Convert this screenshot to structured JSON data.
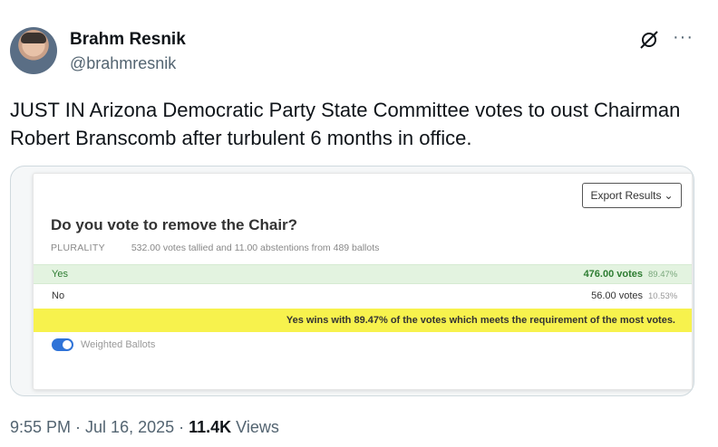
{
  "author": {
    "name": "Brahm Resnik",
    "handle": "@brahmresnik"
  },
  "header_icons": {
    "grok": "grok-slash-icon",
    "more": "more-dots-icon",
    "more_glyph": "···"
  },
  "tweet_text": "JUST IN Arizona Democratic Party State Committee votes to oust Chairman Robert Branscomb after turbulent 6 months in office.",
  "poll": {
    "export_label": "Export Results",
    "question": "Do you vote to remove the Chair?",
    "method": "PLURALITY",
    "summary": "532.00 votes tallied and 11.00 abstentions from 489 ballots",
    "options": [
      {
        "label": "Yes",
        "votes": "476.00 votes",
        "pct": "89.47%",
        "leading": true
      },
      {
        "label": "No",
        "votes": "56.00 votes",
        "pct": "10.53%",
        "leading": false
      }
    ],
    "result_banner": "Yes wins with 89.47% of the votes which meets the requirement of the most votes.",
    "weighted_label": "Weighted Ballots",
    "weighted_on": true,
    "accent_color": "#2f73d8",
    "banner_color": "#f7f24d",
    "leading_color": "#e3f3e0"
  },
  "footer": {
    "time": "9:55 PM",
    "sep1": " · ",
    "date": "Jul 16, 2025",
    "sep2": " · ",
    "views_count": "11.4K",
    "views_label": " Views"
  }
}
